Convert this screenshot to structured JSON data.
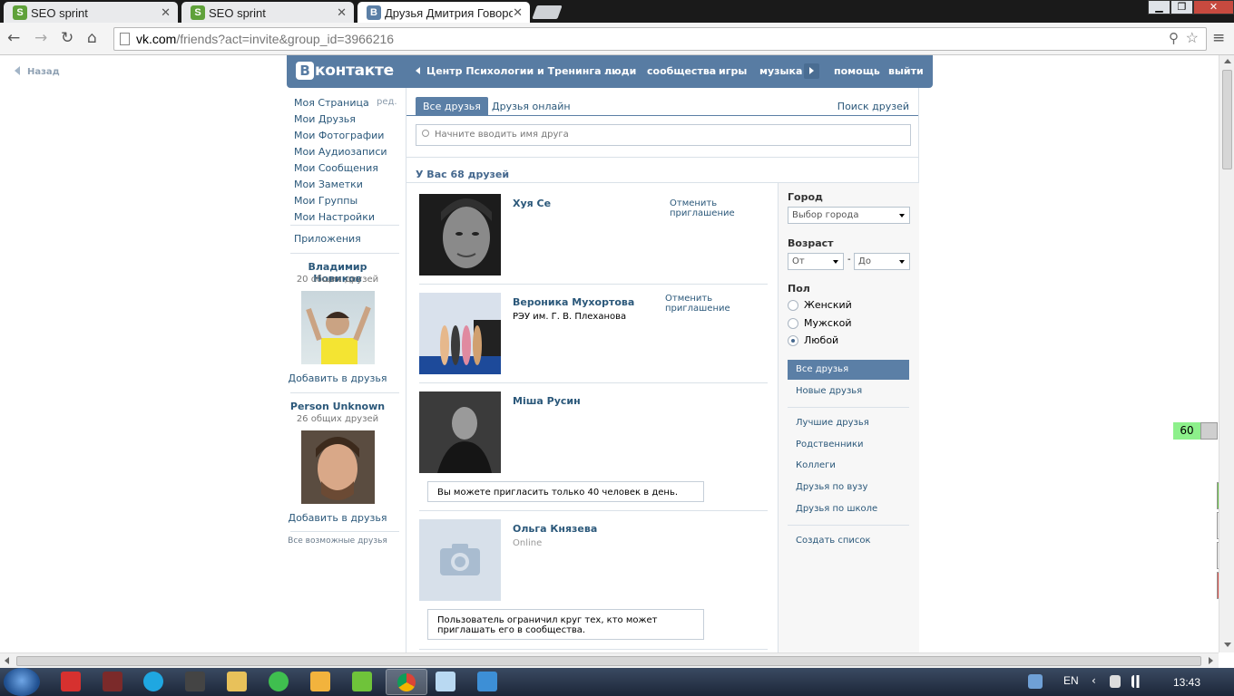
{
  "browser": {
    "tabs": [
      {
        "title": "SEO sprint",
        "favicon": "S"
      },
      {
        "title": "SEO sprint",
        "favicon": "S"
      },
      {
        "title": "Друзья Дмитрия Говоро",
        "favicon": "В"
      }
    ],
    "url_host": "vk.com",
    "url_path": "/friends?act=invite&group_id=3966216",
    "window_buttons": [
      "minimize-icon",
      "restore-icon",
      "close-icon"
    ]
  },
  "vk": {
    "back": "Назад",
    "logo_letter": "В",
    "logo_text": "контакте",
    "group_link": "Центр Психологии и Тренинга ...",
    "nav": [
      "люди",
      "сообщества",
      "игры",
      "музыка",
      "помощь",
      "выйти"
    ],
    "left_menu": [
      "Моя Страница",
      "Мои Друзья",
      "Мои Фотографии",
      "Мои Аудиозаписи",
      "Мои Сообщения",
      "Мои Заметки",
      "Мои Группы",
      "Мои Настройки"
    ],
    "edit_link": "ред.",
    "apps": "Приложения",
    "suggestions": [
      {
        "name": "Владимир Новиков",
        "mutual": "20 общих друзей",
        "action": "Добавить в друзья"
      },
      {
        "name": "Person Unknown",
        "mutual": "26 общих друзей",
        "action": "Добавить в друзья"
      }
    ],
    "all_possible": "Все возможные друзья",
    "tabs": {
      "all": "Все друзья",
      "online": "Друзья онлайн",
      "search": "Поиск друзей"
    },
    "search_placeholder": "Начните вводить имя друга",
    "count_text": "У Вас 68 друзей",
    "friends": [
      {
        "name": "Хуя Се",
        "sub": "",
        "action": "Отменить приглашение"
      },
      {
        "name": "Вероника Мухортова",
        "sub": "РЭУ им. Г. В. Плеханова",
        "action": "Отменить приглашение"
      },
      {
        "name": "Міша Русин",
        "sub": "",
        "action": "",
        "note": "Вы можете пригласить только 40 человек в день."
      },
      {
        "name": "Ольга Князева",
        "sub": "Online",
        "action": "",
        "note": "Пользователь ограничил круг тех, кто может приглашать его в сообщества."
      }
    ],
    "filter": {
      "city_label": "Город",
      "city_value": "Выбор города",
      "age_label": "Возраст",
      "age_from": "От",
      "age_to": "До",
      "age_dash": "-",
      "sex_label": "Пол",
      "sex_options": [
        "Женский",
        "Мужской",
        "Любой"
      ],
      "sex_selected": "Любой",
      "lists": [
        "Все друзья",
        "Новые друзья"
      ],
      "categories": [
        "Лучшие друзья",
        "Родственники",
        "Коллеги",
        "Друзья по вузу",
        "Друзья по школе"
      ],
      "create_list": "Создать список"
    }
  },
  "side_badge": "60",
  "taskbar": {
    "lang": "EN",
    "clock": "13:43"
  },
  "colors": {
    "vk_blue": "#587ca3",
    "link": "#2b587a",
    "badge": "#8df08b"
  }
}
